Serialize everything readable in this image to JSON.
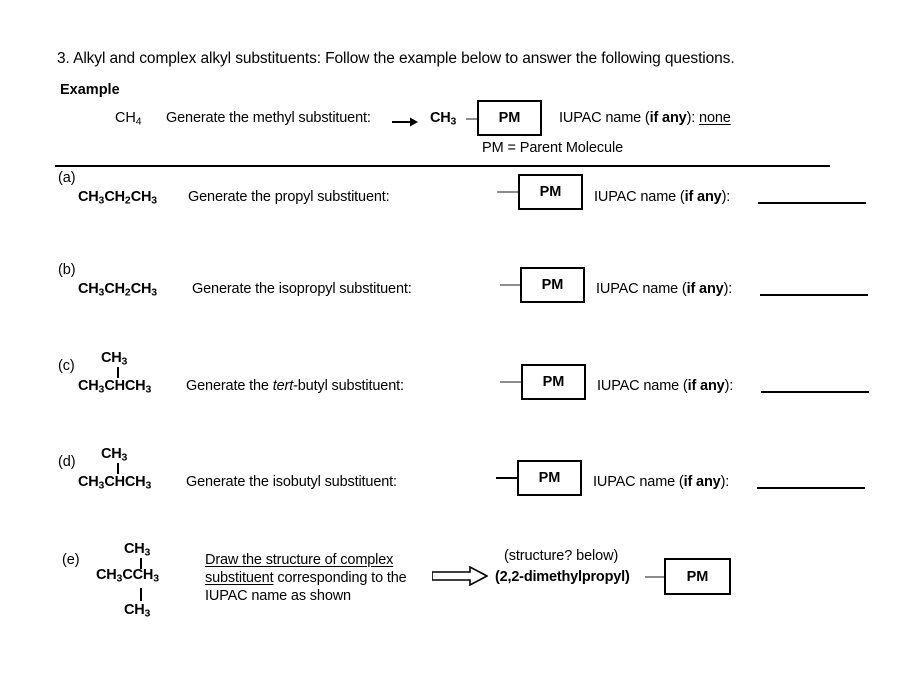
{
  "question": {
    "number": "3.",
    "heading": "3. Alkyl and complex alkyl substituents: Follow the example below to answer the following questions.",
    "example_label": "Example"
  },
  "example": {
    "formula": "CH4",
    "prompt": "Generate the methyl substituent:",
    "arrow_icon": "right-arrow-icon",
    "substituent_label": "CH3",
    "pm_box_label": "PM",
    "iupac_prefix": "IUPAC name (",
    "iupac_bold": "if any",
    "iupac_suffix": "):",
    "answer": "none",
    "legend": "PM = Parent Molecule"
  },
  "rows": [
    {
      "letter": "(a)",
      "formula": "CH3CH2CH3",
      "prompt": "Generate the propyl substituent:",
      "pm_box_label": "PM",
      "iupac_prefix": "IUPAC name (",
      "iupac_bold": "if any",
      "iupac_suffix": "):",
      "answer": ""
    },
    {
      "letter": "(b)",
      "formula": "CH3CH2CH3",
      "prompt": "Generate the isopropyl substituent:",
      "pm_box_label": "PM",
      "iupac_prefix": "IUPAC name (",
      "iupac_bold": "if any",
      "iupac_suffix": "):",
      "answer": ""
    },
    {
      "letter": "(c)",
      "formula_top": "CH3",
      "formula": "CH3CHCH3",
      "prompt_pre": "Generate the ",
      "prompt_italic": "tert",
      "prompt_post": "-butyl substituent:",
      "pm_box_label": "PM",
      "iupac_prefix": "IUPAC name (",
      "iupac_bold": "if any",
      "iupac_suffix": "):",
      "answer": ""
    },
    {
      "letter": "(d)",
      "formula_top": "CH3",
      "formula": "CH3CHCH3",
      "prompt": "Generate the isobutyl substituent:",
      "pm_box_label": "PM",
      "iupac_prefix": "IUPAC name (",
      "iupac_bold": "if any",
      "iupac_suffix": "):",
      "answer": ""
    }
  ],
  "row_e": {
    "letter": "(e)",
    "formula_top": "CH3",
    "formula_mid": "CH3CCH3",
    "formula_bottom": "CH3",
    "instruction_underlined": "Draw the structure of complex substituent",
    "instruction_line1_underlined": "Draw the structure of complex",
    "instruction_line2_underlined": "substituent",
    "instruction_line2_rest": " corresponding to the",
    "instruction_line3": "IUPAC name as shown",
    "arrow_icon": "block-right-arrow-icon",
    "structure_note": "(structure? below)",
    "substituent_name": "(2,2-dimethylpropyl)",
    "pm_box_label": "PM"
  },
  "colors": {
    "ink": "#000000",
    "bond_gray": "#8d8d8d",
    "page": "#ffffff"
  }
}
